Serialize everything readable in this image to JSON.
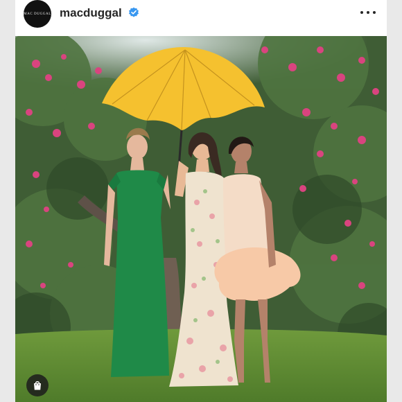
{
  "post": {
    "username": "macduggal",
    "avatar_text": "MAC DUGGAL",
    "verified_icon": "verified-badge-icon",
    "more_icon": "more-options-icon",
    "shop_icon": "shopping-bag-icon"
  },
  "colors": {
    "verified": "#3897f0",
    "umbrella": "#f5c12f",
    "green_dress": "#1f8a48",
    "grass": "#5e8a32"
  }
}
